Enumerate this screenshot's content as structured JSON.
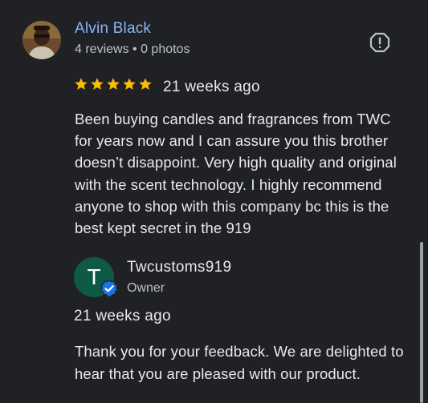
{
  "review": {
    "reviewer_name": "Alvin Black",
    "reviewer_meta": "4 reviews • 0 photos",
    "rating": 5,
    "rating_max": 5,
    "age": "21 weeks ago",
    "text": "Been buying candles and fragrances from TWC for years now and I can assure you this brother doesn’t disappoint. Very high quality and original with the scent technology. I highly recommend anyone to shop with this company bc this is the best kept secret in the 919",
    "report_icon": "report-flag-icon",
    "star_color": "#fbbc04"
  },
  "owner_reply": {
    "avatar_letter": "T",
    "avatar_color": "#0f5a46",
    "badge_icon": "verified-check-icon",
    "badge_color": "#1a73e8",
    "name": "Twcustoms919",
    "role": "Owner",
    "age": "21 weeks ago",
    "text": "Thank you for your feedback. We are delighted to hear that you are pleased with our product."
  },
  "theme": {
    "background": "#202124",
    "link_color": "#8ab4f8",
    "text_color": "#e8eaed",
    "secondary_text": "#bdc1c6"
  }
}
